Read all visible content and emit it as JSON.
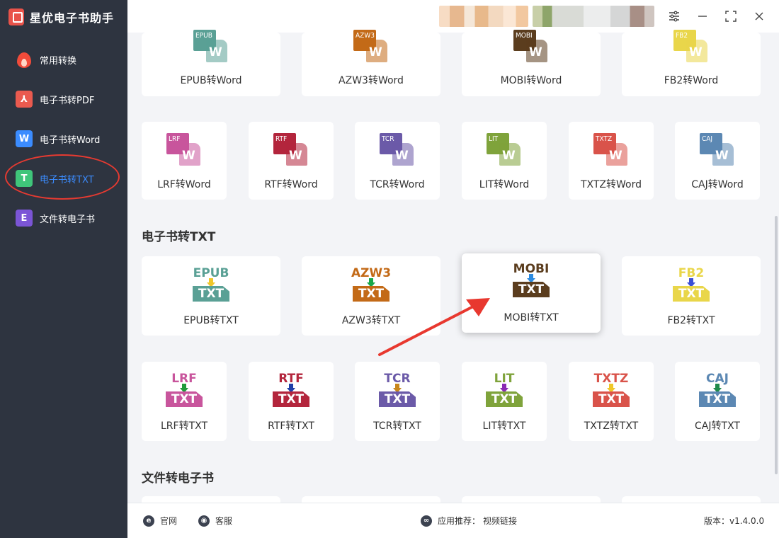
{
  "app": {
    "title": "星优电子书助手"
  },
  "sidebar": {
    "items": [
      {
        "label": "常用转换",
        "icon": "flame-icon",
        "color": "#f14b3a"
      },
      {
        "label": "电子书转PDF",
        "icon": "pdf-icon",
        "color": "#ea5a4f"
      },
      {
        "label": "电子书转Word",
        "icon": "word-icon",
        "color": "#3b8cff"
      },
      {
        "label": "电子书转TXT",
        "icon": "txt-icon",
        "color": "#3fc57a",
        "active": true
      },
      {
        "label": "文件转电子书",
        "icon": "ebook-icon",
        "color": "#7b55d6"
      }
    ]
  },
  "word_row1": [
    {
      "fmt": "EPUB",
      "label": "EPUB转Word",
      "color": "#5aa095"
    },
    {
      "fmt": "AZW3",
      "label": "AZW3转Word",
      "color": "#c36a17"
    },
    {
      "fmt": "MOBI",
      "label": "MOBI转Word",
      "color": "#5b3d1e"
    },
    {
      "fmt": "FB2",
      "label": "FB2转Word",
      "color": "#e9d64a"
    }
  ],
  "word_row2": [
    {
      "fmt": "LRF",
      "label": "LRF转Word",
      "color": "#c8559c"
    },
    {
      "fmt": "RTF",
      "label": "RTF转Word",
      "color": "#b3253c"
    },
    {
      "fmt": "TCR",
      "label": "TCR转Word",
      "color": "#6b5aa8"
    },
    {
      "fmt": "LIT",
      "label": "LIT转Word",
      "color": "#7fa33b"
    },
    {
      "fmt": "TXTZ",
      "label": "TXTZ转Word",
      "color": "#d9534a"
    },
    {
      "fmt": "CAJ",
      "label": "CAJ转Word",
      "color": "#5c88b3"
    }
  ],
  "sections": {
    "txt": "电子书转TXT",
    "file": "文件转电子书"
  },
  "txt_row1": [
    {
      "fmt": "EPUB",
      "label": "EPUB转TXT",
      "color": "#5aa095",
      "arrow": "#f0c72a"
    },
    {
      "fmt": "AZW3",
      "label": "AZW3转TXT",
      "color": "#c36a17",
      "arrow": "#17a84a"
    },
    {
      "fmt": "MOBI",
      "label": "MOBI转TXT",
      "color": "#5b3d1e",
      "arrow": "#2d8be0"
    },
    {
      "fmt": "FB2",
      "label": "FB2转TXT",
      "color": "#e9d64a",
      "arrow": "#3b4fd6"
    }
  ],
  "txt_row2": [
    {
      "fmt": "LRF",
      "label": "LRF转TXT",
      "color": "#c8559c",
      "arrow": "#1f9b3a"
    },
    {
      "fmt": "RTF",
      "label": "RTF转TXT",
      "color": "#b3253c",
      "arrow": "#1f3fa8"
    },
    {
      "fmt": "TCR",
      "label": "TCR转TXT",
      "color": "#6b5aa8",
      "arrow": "#c8861a"
    },
    {
      "fmt": "LIT",
      "label": "LIT转TXT",
      "color": "#7fa33b",
      "arrow": "#8a2bb3"
    },
    {
      "fmt": "TXTZ",
      "label": "TXTZ转TXT",
      "color": "#d9534a",
      "arrow": "#f0c72a"
    },
    {
      "fmt": "CAJ",
      "label": "CAJ转TXT",
      "color": "#5c88b3",
      "arrow": "#1f8a4a"
    }
  ],
  "footer": {
    "website": "官网",
    "support": "客服",
    "recommend_label": "应用推荐：",
    "recommend_link": "视频链接",
    "version": "版本：v1.4.0.0"
  }
}
